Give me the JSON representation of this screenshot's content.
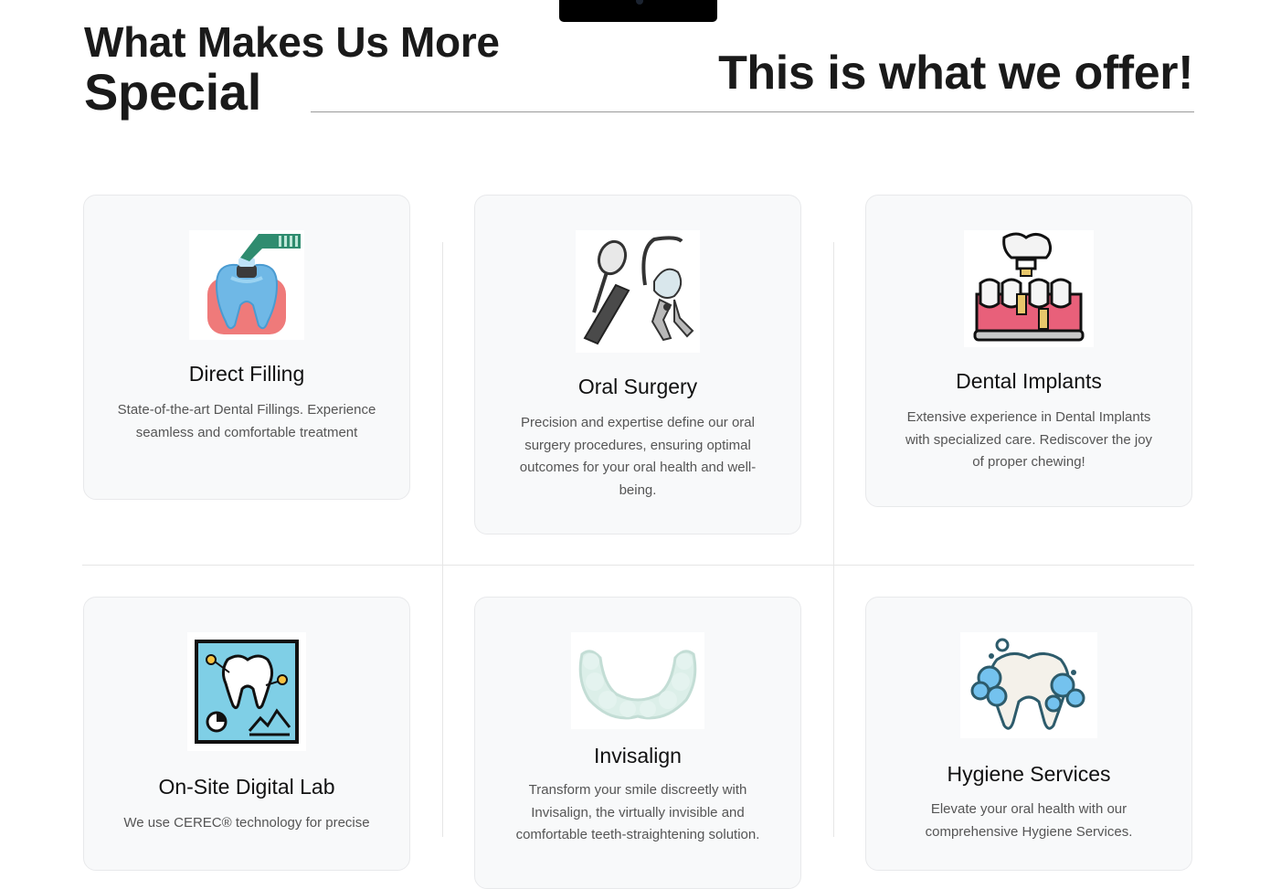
{
  "header": {
    "title_line1": "What Makes Us More",
    "title_line2": "Special",
    "tagline": "This is what we offer!"
  },
  "services": [
    {
      "title": "Direct Filling",
      "description": "State-of-the-art Dental Fillings. Experience seamless and comfortable treatment",
      "icon": "tooth-filling-icon"
    },
    {
      "title": "Oral Surgery",
      "description": "Precision and expertise define our oral surgery procedures, ensuring optimal outcomes for your oral health and well-being.",
      "icon": "surgical-tools-icon"
    },
    {
      "title": "Dental  Implants",
      "description": "Extensive experience in Dental Implants with specialized care. Rediscover the joy of proper chewing!",
      "icon": "dental-implant-icon"
    },
    {
      "title": "On-Site Digital Lab",
      "description": "We use CEREC® technology for precise",
      "icon": "digital-xray-icon"
    },
    {
      "title": "Invisalign",
      "description": "Transform your smile discreetly with Invisalign, the virtually invisible and comfortable teeth-straightening solution.",
      "icon": "clear-aligner-icon"
    },
    {
      "title": "Hygiene Services",
      "description": "Elevate your oral health with our comprehensive Hygiene Services.",
      "icon": "clean-tooth-icon"
    }
  ],
  "colors": {
    "card_bg": "#f8f9fa",
    "heading": "#1a1a1a",
    "body_text": "#555555",
    "rule": "#9a9a9a"
  }
}
